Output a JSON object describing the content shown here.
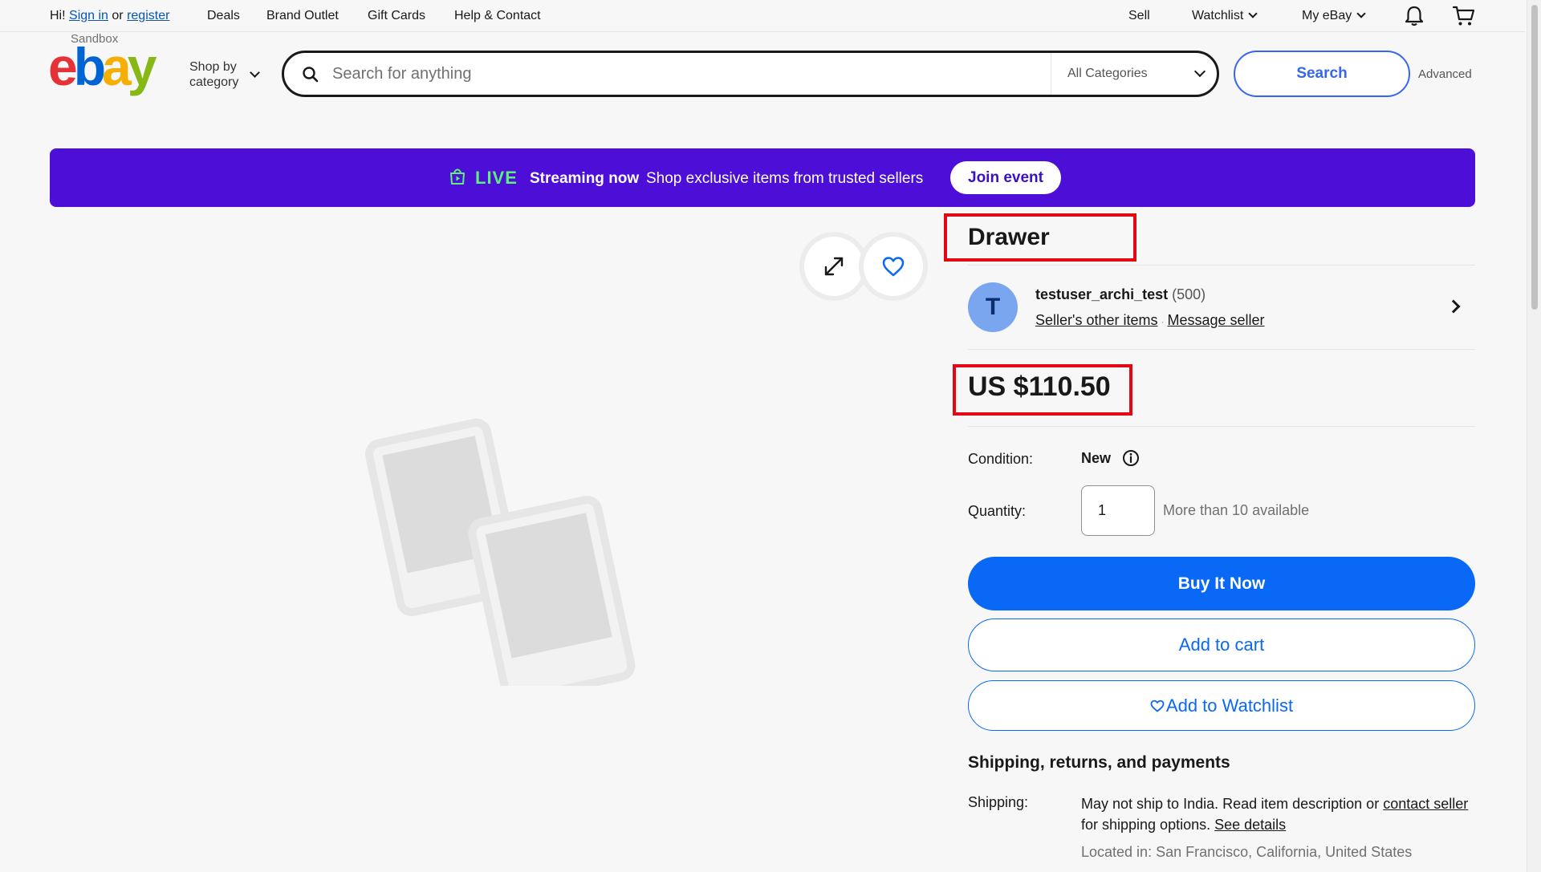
{
  "topbar": {
    "greeting_prefix": "Hi!",
    "sign_in": "Sign in",
    "or": "or",
    "register": "register",
    "nav": [
      "Deals",
      "Brand Outlet",
      "Gift Cards",
      "Help & Contact"
    ],
    "sell": "Sell",
    "watchlist": "Watchlist",
    "my_ebay": "My eBay"
  },
  "header": {
    "sandbox_label": "Sandbox",
    "logo": {
      "e": "e",
      "b": "b",
      "a": "a",
      "y": "y"
    },
    "shop_by_category_line1": "Shop by",
    "shop_by_category_line2": "category",
    "search_placeholder": "Search for anything",
    "category_selected": "All Categories",
    "search_button": "Search",
    "advanced_link": "Advanced"
  },
  "live_banner": {
    "live": "LIVE",
    "streaming": "Streaming now",
    "description": "Shop exclusive items from trusted sellers",
    "join_button": "Join event"
  },
  "item": {
    "title": "Drawer",
    "seller": {
      "avatar_letter": "T",
      "name": "testuser_archi_test",
      "feedback_count": "(500)",
      "other_items": "Seller's other items",
      "message": "Message seller"
    },
    "price": "US $110.50",
    "condition_label": "Condition:",
    "condition_value": "New",
    "quantity_label": "Quantity:",
    "quantity_value": "1",
    "availability": "More than 10 available",
    "buy_now": "Buy It Now",
    "add_to_cart": "Add to cart",
    "add_to_watchlist": "Add to Watchlist"
  },
  "shipping": {
    "heading": "Shipping, returns, and payments",
    "label": "Shipping:",
    "text_part1": "May not ship to India. Read item description or",
    "contact_seller": "contact seller",
    "text_part2": "for shipping options.",
    "see_details": "See details",
    "located": "Located in: San Francisco, California, United States"
  },
  "colors": {
    "brand_blue": "#3665f3",
    "buy_button": "#0968f6",
    "live_banner": "#4d0fd8",
    "live_green": "#5df17a",
    "highlight_red": "#e30613"
  }
}
